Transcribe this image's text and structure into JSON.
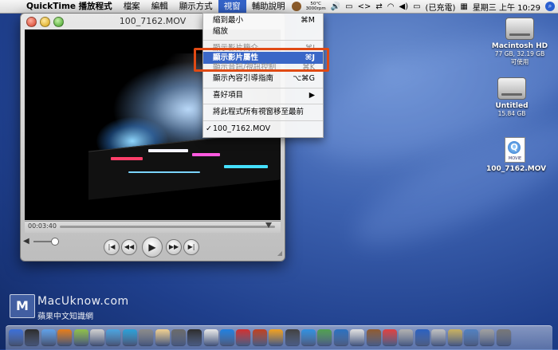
{
  "menubar": {
    "app_name": "QuickTime 播放程式",
    "menus": [
      "檔案",
      "編輯",
      "顯示方式",
      "視窗",
      "輔助說明"
    ],
    "active_menu": "視窗",
    "temperature": "50°C",
    "fan": "3000rpm",
    "battery": "(已充電)",
    "clock": "星期三 上午 10:29"
  },
  "window": {
    "title": "100_7162.MOV",
    "timecode": "00:03:40",
    "playhead_fraction": 0.97
  },
  "dropdown": {
    "items": [
      {
        "label": "縮到最小",
        "shortcut": "⌘M"
      },
      {
        "label": "縮放",
        "shortcut": ""
      },
      {
        "label": "顯示影片簡介",
        "shortcut": "⌘I"
      },
      {
        "label": "顯示影片屬性",
        "shortcut": "⌘J"
      },
      {
        "label": "顯示音訊/視訊控制",
        "shortcut": "⌘K"
      },
      {
        "label": "顯示內容引導指南",
        "shortcut": "⌥⌘G"
      },
      {
        "label": "喜好項目",
        "shortcut": "▶"
      },
      {
        "label": "將此程式所有視窗移至最前",
        "shortcut": ""
      },
      {
        "label": "100_7162.MOV",
        "shortcut": ""
      }
    ],
    "highlighted_index": 3,
    "checked_index": 8
  },
  "desktop_icons": [
    {
      "name": "Macintosh HD",
      "sub": "77 GB, 32.19 GB 可使用"
    },
    {
      "name": "Untitled",
      "sub": "15.84 GB"
    },
    {
      "name": "100_7162.MOV",
      "sub": "",
      "badge": "MOVIE"
    }
  ],
  "watermark": {
    "logo_letter": "M",
    "line1": "MacUknow.com",
    "line2": "蘋果中文知識網"
  },
  "colors": {
    "menu_highlight": "#3a67c7",
    "callout": "#e04a14"
  }
}
